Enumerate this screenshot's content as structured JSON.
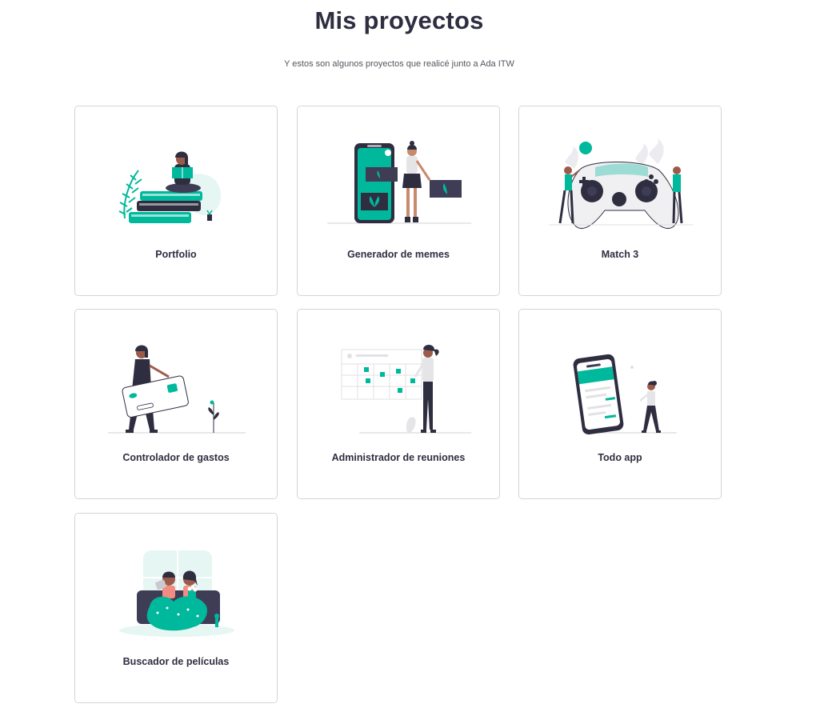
{
  "header": {
    "title": "Mis proyectos",
    "subtitle": "Y estos son algunos proyectos que realicé junto a Ada ITW"
  },
  "colors": {
    "accent": "#00b89c",
    "dark": "#2f2e41",
    "border": "#d5d5d9"
  },
  "projects": [
    {
      "label": "Portfolio",
      "icon": "woman-reading-books-illustration"
    },
    {
      "label": "Generador de memes",
      "icon": "woman-phone-images-illustration"
    },
    {
      "label": "Match 3",
      "icon": "game-controller-illustration"
    },
    {
      "label": "Controlador de gastos",
      "icon": "woman-credit-card-illustration"
    },
    {
      "label": "Administrador de reuniones",
      "icon": "woman-calendar-illustration"
    },
    {
      "label": "Todo app",
      "icon": "woman-phone-list-illustration"
    },
    {
      "label": "Buscador de películas",
      "icon": "women-couch-popcorn-illustration"
    }
  ]
}
